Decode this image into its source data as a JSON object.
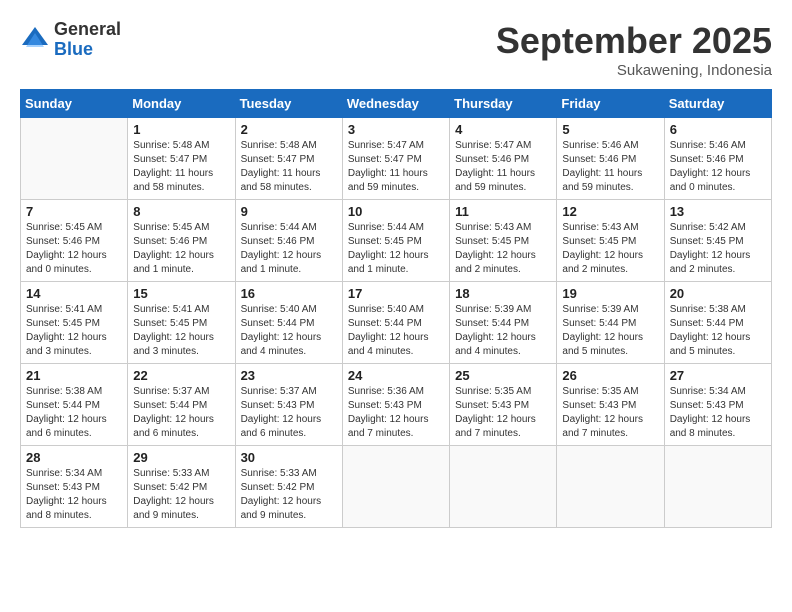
{
  "logo": {
    "general": "General",
    "blue": "Blue"
  },
  "header": {
    "month": "September 2025",
    "location": "Sukawening, Indonesia"
  },
  "days_of_week": [
    "Sunday",
    "Monday",
    "Tuesday",
    "Wednesday",
    "Thursday",
    "Friday",
    "Saturday"
  ],
  "weeks": [
    [
      {
        "day": "",
        "sunrise": "",
        "sunset": "",
        "daylight": ""
      },
      {
        "day": "1",
        "sunrise": "Sunrise: 5:48 AM",
        "sunset": "Sunset: 5:47 PM",
        "daylight": "Daylight: 11 hours and 58 minutes."
      },
      {
        "day": "2",
        "sunrise": "Sunrise: 5:48 AM",
        "sunset": "Sunset: 5:47 PM",
        "daylight": "Daylight: 11 hours and 58 minutes."
      },
      {
        "day": "3",
        "sunrise": "Sunrise: 5:47 AM",
        "sunset": "Sunset: 5:47 PM",
        "daylight": "Daylight: 11 hours and 59 minutes."
      },
      {
        "day": "4",
        "sunrise": "Sunrise: 5:47 AM",
        "sunset": "Sunset: 5:46 PM",
        "daylight": "Daylight: 11 hours and 59 minutes."
      },
      {
        "day": "5",
        "sunrise": "Sunrise: 5:46 AM",
        "sunset": "Sunset: 5:46 PM",
        "daylight": "Daylight: 11 hours and 59 minutes."
      },
      {
        "day": "6",
        "sunrise": "Sunrise: 5:46 AM",
        "sunset": "Sunset: 5:46 PM",
        "daylight": "Daylight: 12 hours and 0 minutes."
      }
    ],
    [
      {
        "day": "7",
        "sunrise": "Sunrise: 5:45 AM",
        "sunset": "Sunset: 5:46 PM",
        "daylight": "Daylight: 12 hours and 0 minutes."
      },
      {
        "day": "8",
        "sunrise": "Sunrise: 5:45 AM",
        "sunset": "Sunset: 5:46 PM",
        "daylight": "Daylight: 12 hours and 1 minute."
      },
      {
        "day": "9",
        "sunrise": "Sunrise: 5:44 AM",
        "sunset": "Sunset: 5:46 PM",
        "daylight": "Daylight: 12 hours and 1 minute."
      },
      {
        "day": "10",
        "sunrise": "Sunrise: 5:44 AM",
        "sunset": "Sunset: 5:45 PM",
        "daylight": "Daylight: 12 hours and 1 minute."
      },
      {
        "day": "11",
        "sunrise": "Sunrise: 5:43 AM",
        "sunset": "Sunset: 5:45 PM",
        "daylight": "Daylight: 12 hours and 2 minutes."
      },
      {
        "day": "12",
        "sunrise": "Sunrise: 5:43 AM",
        "sunset": "Sunset: 5:45 PM",
        "daylight": "Daylight: 12 hours and 2 minutes."
      },
      {
        "day": "13",
        "sunrise": "Sunrise: 5:42 AM",
        "sunset": "Sunset: 5:45 PM",
        "daylight": "Daylight: 12 hours and 2 minutes."
      }
    ],
    [
      {
        "day": "14",
        "sunrise": "Sunrise: 5:41 AM",
        "sunset": "Sunset: 5:45 PM",
        "daylight": "Daylight: 12 hours and 3 minutes."
      },
      {
        "day": "15",
        "sunrise": "Sunrise: 5:41 AM",
        "sunset": "Sunset: 5:45 PM",
        "daylight": "Daylight: 12 hours and 3 minutes."
      },
      {
        "day": "16",
        "sunrise": "Sunrise: 5:40 AM",
        "sunset": "Sunset: 5:44 PM",
        "daylight": "Daylight: 12 hours and 4 minutes."
      },
      {
        "day": "17",
        "sunrise": "Sunrise: 5:40 AM",
        "sunset": "Sunset: 5:44 PM",
        "daylight": "Daylight: 12 hours and 4 minutes."
      },
      {
        "day": "18",
        "sunrise": "Sunrise: 5:39 AM",
        "sunset": "Sunset: 5:44 PM",
        "daylight": "Daylight: 12 hours and 4 minutes."
      },
      {
        "day": "19",
        "sunrise": "Sunrise: 5:39 AM",
        "sunset": "Sunset: 5:44 PM",
        "daylight": "Daylight: 12 hours and 5 minutes."
      },
      {
        "day": "20",
        "sunrise": "Sunrise: 5:38 AM",
        "sunset": "Sunset: 5:44 PM",
        "daylight": "Daylight: 12 hours and 5 minutes."
      }
    ],
    [
      {
        "day": "21",
        "sunrise": "Sunrise: 5:38 AM",
        "sunset": "Sunset: 5:44 PM",
        "daylight": "Daylight: 12 hours and 6 minutes."
      },
      {
        "day": "22",
        "sunrise": "Sunrise: 5:37 AM",
        "sunset": "Sunset: 5:44 PM",
        "daylight": "Daylight: 12 hours and 6 minutes."
      },
      {
        "day": "23",
        "sunrise": "Sunrise: 5:37 AM",
        "sunset": "Sunset: 5:43 PM",
        "daylight": "Daylight: 12 hours and 6 minutes."
      },
      {
        "day": "24",
        "sunrise": "Sunrise: 5:36 AM",
        "sunset": "Sunset: 5:43 PM",
        "daylight": "Daylight: 12 hours and 7 minutes."
      },
      {
        "day": "25",
        "sunrise": "Sunrise: 5:35 AM",
        "sunset": "Sunset: 5:43 PM",
        "daylight": "Daylight: 12 hours and 7 minutes."
      },
      {
        "day": "26",
        "sunrise": "Sunrise: 5:35 AM",
        "sunset": "Sunset: 5:43 PM",
        "daylight": "Daylight: 12 hours and 7 minutes."
      },
      {
        "day": "27",
        "sunrise": "Sunrise: 5:34 AM",
        "sunset": "Sunset: 5:43 PM",
        "daylight": "Daylight: 12 hours and 8 minutes."
      }
    ],
    [
      {
        "day": "28",
        "sunrise": "Sunrise: 5:34 AM",
        "sunset": "Sunset: 5:43 PM",
        "daylight": "Daylight: 12 hours and 8 minutes."
      },
      {
        "day": "29",
        "sunrise": "Sunrise: 5:33 AM",
        "sunset": "Sunset: 5:42 PM",
        "daylight": "Daylight: 12 hours and 9 minutes."
      },
      {
        "day": "30",
        "sunrise": "Sunrise: 5:33 AM",
        "sunset": "Sunset: 5:42 PM",
        "daylight": "Daylight: 12 hours and 9 minutes."
      },
      {
        "day": "",
        "sunrise": "",
        "sunset": "",
        "daylight": ""
      },
      {
        "day": "",
        "sunrise": "",
        "sunset": "",
        "daylight": ""
      },
      {
        "day": "",
        "sunrise": "",
        "sunset": "",
        "daylight": ""
      },
      {
        "day": "",
        "sunrise": "",
        "sunset": "",
        "daylight": ""
      }
    ]
  ]
}
